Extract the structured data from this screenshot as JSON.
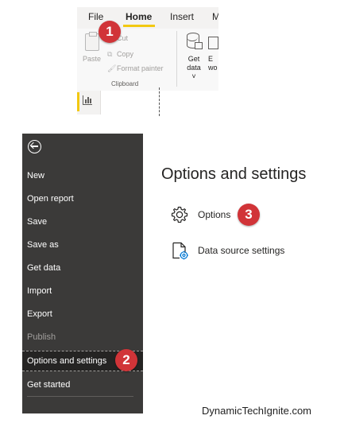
{
  "ribbon": {
    "tabs": [
      "File",
      "Home",
      "Insert",
      "M"
    ],
    "active_tab": "Home",
    "paste_label": "Paste",
    "cut_label": "Cut",
    "copy_label": "Copy",
    "format_painter_label": "Format painter",
    "group_label": "Clipboard",
    "get_data_label_1": "Get",
    "get_data_label_2": "data",
    "next_button_label_1": "E",
    "next_button_label_2": "wo"
  },
  "backstage": {
    "items": [
      {
        "label": "New",
        "enabled": true
      },
      {
        "label": "Open report",
        "enabled": true
      },
      {
        "label": "Save",
        "enabled": true
      },
      {
        "label": "Save as",
        "enabled": true
      },
      {
        "label": "Get data",
        "enabled": true
      },
      {
        "label": "Import",
        "enabled": true
      },
      {
        "label": "Export",
        "enabled": true
      },
      {
        "label": "Publish",
        "enabled": false
      },
      {
        "label": "Options and settings",
        "enabled": true,
        "selected": true
      },
      {
        "label": "Get started",
        "enabled": true
      }
    ]
  },
  "pane": {
    "title": "Options and settings",
    "options": [
      {
        "label": "Options",
        "icon": "gear-icon"
      },
      {
        "label": "Data source settings",
        "icon": "data-source-settings-icon"
      }
    ]
  },
  "badges": [
    "1",
    "2",
    "3"
  ],
  "colors": {
    "accent": "#f2c811",
    "badge": "#d13438",
    "backstage": "#3b3a39"
  },
  "watermark": "DynamicTechIgnite.com"
}
